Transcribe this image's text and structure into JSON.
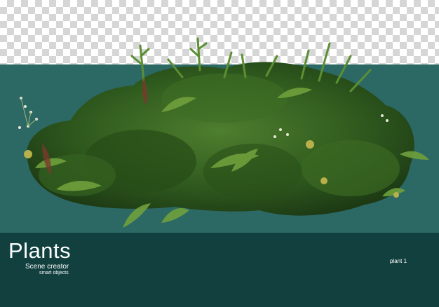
{
  "image": {
    "subject": "plant-arrangement",
    "colors": {
      "teal_panel": "#2c6864",
      "footer": "#12403f",
      "checker": "#d6d6d6"
    }
  },
  "caption": {
    "title": "Plants",
    "subtitle": "Scene creator",
    "subtitle_small": "smart objects",
    "tag": "plant 1"
  }
}
